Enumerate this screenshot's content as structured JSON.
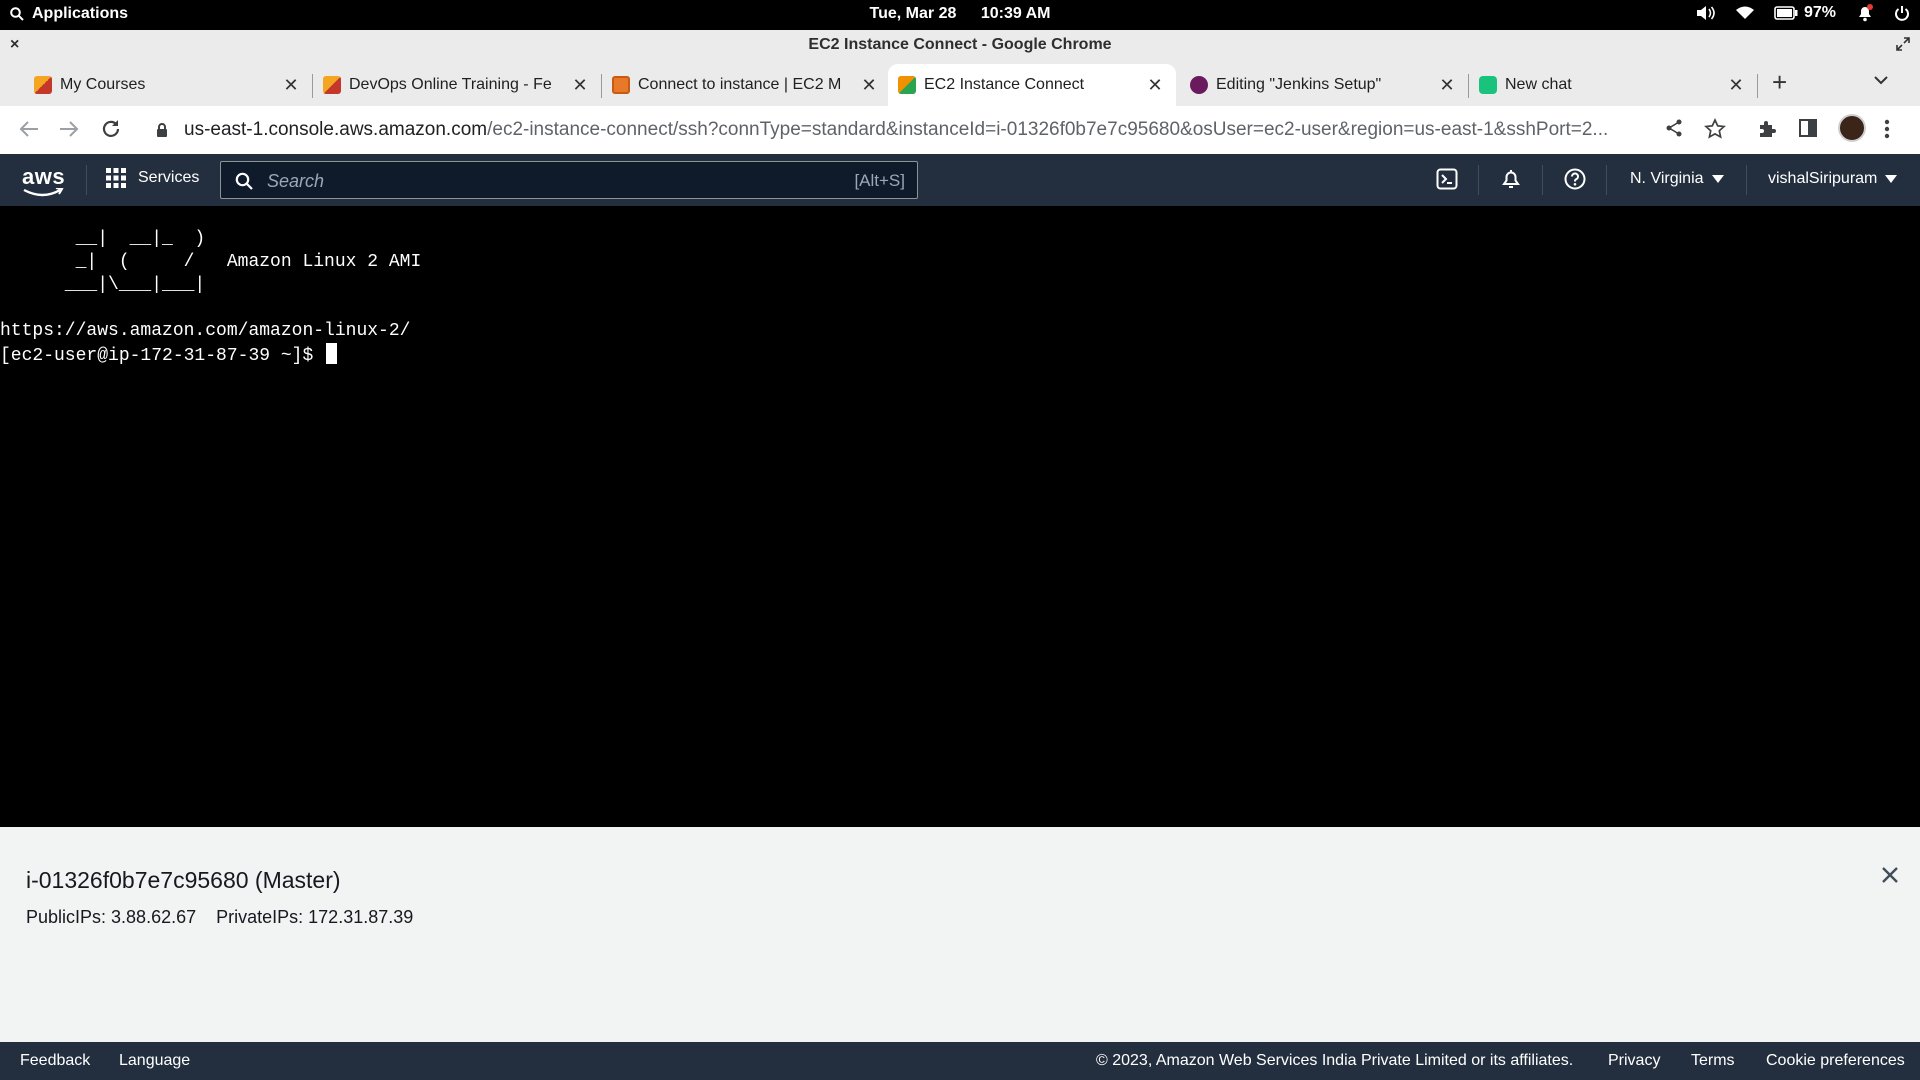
{
  "os_bar": {
    "apps_label": "Applications",
    "date": "Tue, Mar 28",
    "time": "10:39 AM",
    "battery": "97%"
  },
  "window": {
    "title": "EC2 Instance Connect - Google Chrome"
  },
  "tabs": [
    {
      "label": "My Courses",
      "icon": "courses-favicon",
      "active": false
    },
    {
      "label": "DevOps Online Training - Fe",
      "icon": "courses-favicon",
      "active": false
    },
    {
      "label": "Connect to instance | EC2 M",
      "icon": "ec2-favicon",
      "active": false
    },
    {
      "label": "EC2 Instance Connect",
      "icon": "ec2-connect-favicon",
      "active": true
    },
    {
      "label": "Editing \"Jenkins Setup\"",
      "icon": "editor-favicon",
      "active": false
    },
    {
      "label": "New chat",
      "icon": "chat-favicon",
      "active": false
    }
  ],
  "address_bar": {
    "host": "us-east-1.console.aws.amazon.com",
    "path": "/ec2-instance-connect/ssh?connType=standard&instanceId=i-01326f0b7e7c95680&osUser=ec2-user&region=us-east-1&sshPort=2..."
  },
  "aws_header": {
    "logo_text": "aws",
    "services_label": "Services",
    "search_placeholder": "Search",
    "search_shortcut": "[Alt+S]",
    "region": "N. Virginia",
    "user": "vishalSiripuram"
  },
  "terminal": {
    "lines": [
      "       __|  __|_  )",
      "       _|  (     /   Amazon Linux 2 AMI",
      "      ___|\\___|___|",
      "",
      "https://aws.amazon.com/amazon-linux-2/",
      "[ec2-user@ip-172-31-87-39 ~]$ "
    ]
  },
  "instance": {
    "name": "i-01326f0b7e7c95680 (Master)",
    "public_ips": "PublicIPs: 3.88.62.67",
    "private_ips": "PrivateIPs: 172.31.87.39"
  },
  "footer": {
    "feedback": "Feedback",
    "language": "Language",
    "copyright": "© 2023, Amazon Web Services India Private Limited or its affiliates.",
    "privacy": "Privacy",
    "terms": "Terms",
    "cookies": "Cookie preferences"
  },
  "colors": {
    "aws_nav": "#232f3e",
    "terminal_bg": "#000000",
    "panel_bg": "#f2f3f3",
    "aws_orange": "#ff9900"
  }
}
